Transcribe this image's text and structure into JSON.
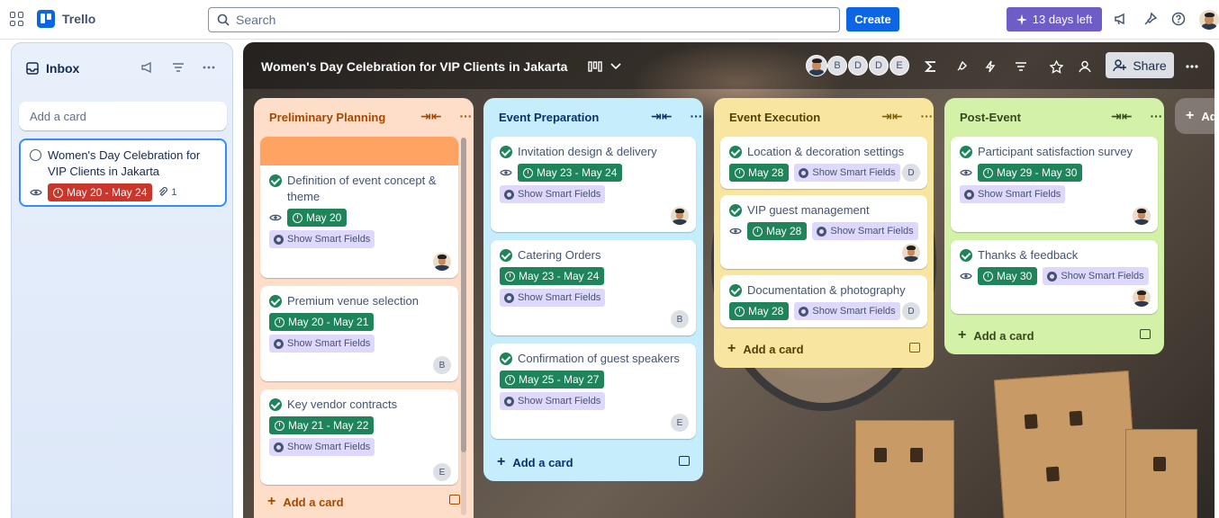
{
  "topbar": {
    "app_name": "Trello",
    "search_placeholder": "Search",
    "create_label": "Create",
    "trial_label": "13 days left"
  },
  "inbox": {
    "title": "Inbox",
    "add_card_placeholder": "Add a card",
    "card": {
      "title": "Women's Day Celebration for VIP Clients in Jakarta",
      "date": "May 20 - May 24",
      "attachments": "1"
    }
  },
  "board": {
    "title": "Women's Day Celebration for VIP Clients in Jakarta",
    "members": [
      "B",
      "D",
      "D",
      "E"
    ],
    "share_label": "Share",
    "add_list_label": "Ad"
  },
  "lists": [
    {
      "title": "Preliminary Planning",
      "add_label": "Add a card",
      "cards": [
        {
          "title": "Definition of event concept & theme",
          "date": "May 20",
          "smart": "Show Smart Fields",
          "member": "avatar"
        },
        {
          "title": "Premium venue selection",
          "date": "May 20 - May 21",
          "smart": "Show Smart Fields",
          "member": "B"
        },
        {
          "title": "Key vendor contracts",
          "date": "May 21 - May 22",
          "smart": "Show Smart Fields",
          "member": "E"
        }
      ]
    },
    {
      "title": "Event Preparation",
      "add_label": "Add a card",
      "cards": [
        {
          "title": "Invitation design & delivery",
          "date": "May 23 - May 24",
          "smart": "Show Smart Fields",
          "member": "avatar"
        },
        {
          "title": "Catering Orders",
          "date": "May 23 - May 24",
          "smart": "Show Smart Fields",
          "member": "B"
        },
        {
          "title": "Confirmation of guest speakers",
          "date": "May 25 - May 27",
          "smart": "Show Smart Fields",
          "member": "E"
        }
      ]
    },
    {
      "title": "Event Execution",
      "add_label": "Add a card",
      "cards": [
        {
          "title": "Location & decoration settings",
          "date": "May 28",
          "smart": "Show Smart Fields",
          "member": "D"
        },
        {
          "title": "VIP guest management",
          "date": "May 28",
          "smart": "Show Smart Fields",
          "member": "avatar"
        },
        {
          "title": "Documentation & photography",
          "date": "May 28",
          "smart": "Show Smart Fields",
          "member": "D"
        }
      ]
    },
    {
      "title": "Post-Event",
      "add_label": "Add a card",
      "cards": [
        {
          "title": "Participant satisfaction survey",
          "date": "May 29 - May 30",
          "smart": "Show Smart Fields",
          "member": "avatar"
        },
        {
          "title": "Thanks & feedback",
          "date": "May 30",
          "smart": "Show Smart Fields",
          "member": "avatar"
        }
      ]
    }
  ],
  "colors": {
    "brand": "#0c66e4",
    "trial": "#6e5dc6",
    "list_planning": "#fedec8",
    "list_preparation": "#c6edfb",
    "list_execution": "#f8e6a0",
    "list_post": "#d3f1a7",
    "date_green": "#1f845a",
    "date_red": "#c9372c"
  }
}
